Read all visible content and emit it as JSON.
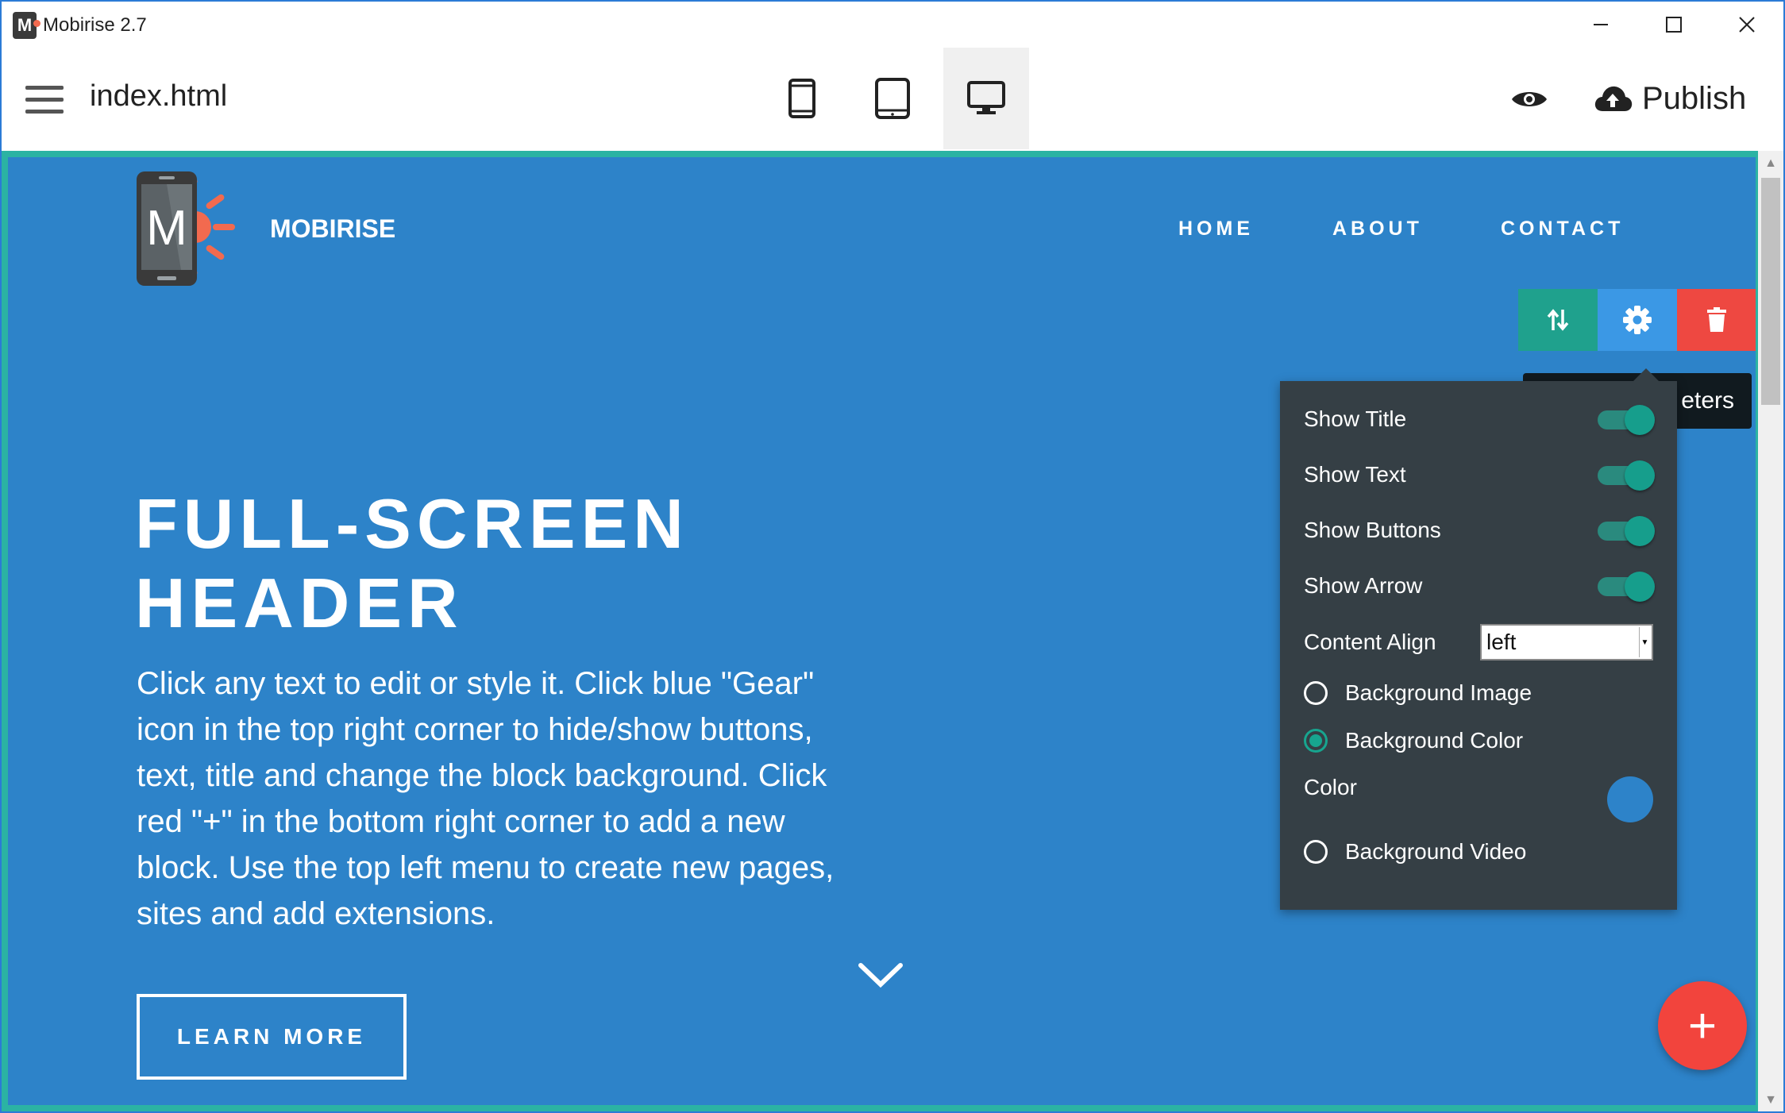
{
  "window": {
    "title": "Mobirise 2.7",
    "icon_letter": "M"
  },
  "toolbar": {
    "file_name": "index.html",
    "publish_label": "Publish",
    "active_device": "desktop"
  },
  "site": {
    "brand": "MOBIRISE",
    "logo_letter": "M",
    "nav": [
      "HOME",
      "ABOUT",
      "CONTACT"
    ],
    "title_line1": "FULL-SCREEN",
    "title_line2": "HEADER",
    "text": "Click any text to edit or style it. Click blue \"Gear\" icon in the top right corner to hide/show buttons, text, title and change the block background. Click red \"+\" in the bottom right corner to add a new block. Use the top left menu to create new pages, sites and add extensions.",
    "button_label": "LEARN MORE"
  },
  "tooltip": "eters",
  "parameters": {
    "toggles": [
      {
        "label": "Show Title",
        "on": true
      },
      {
        "label": "Show Text",
        "on": true
      },
      {
        "label": "Show Buttons",
        "on": true
      },
      {
        "label": "Show Arrow",
        "on": true
      }
    ],
    "content_align_label": "Content Align",
    "content_align_value": "left",
    "background_image_label": "Background Image",
    "background_color_label": "Background Color",
    "color_label": "Color",
    "color_value": "#2d83c9",
    "background_video_label": "Background Video",
    "selected_background": "color"
  },
  "add_block_label": "+",
  "colors": {
    "hero_bg": "#2d83c9",
    "accent_teal": "#1fa18d",
    "accent_blue": "#3b98e5",
    "accent_red": "#ee4841",
    "panel_bg": "#353f45"
  }
}
